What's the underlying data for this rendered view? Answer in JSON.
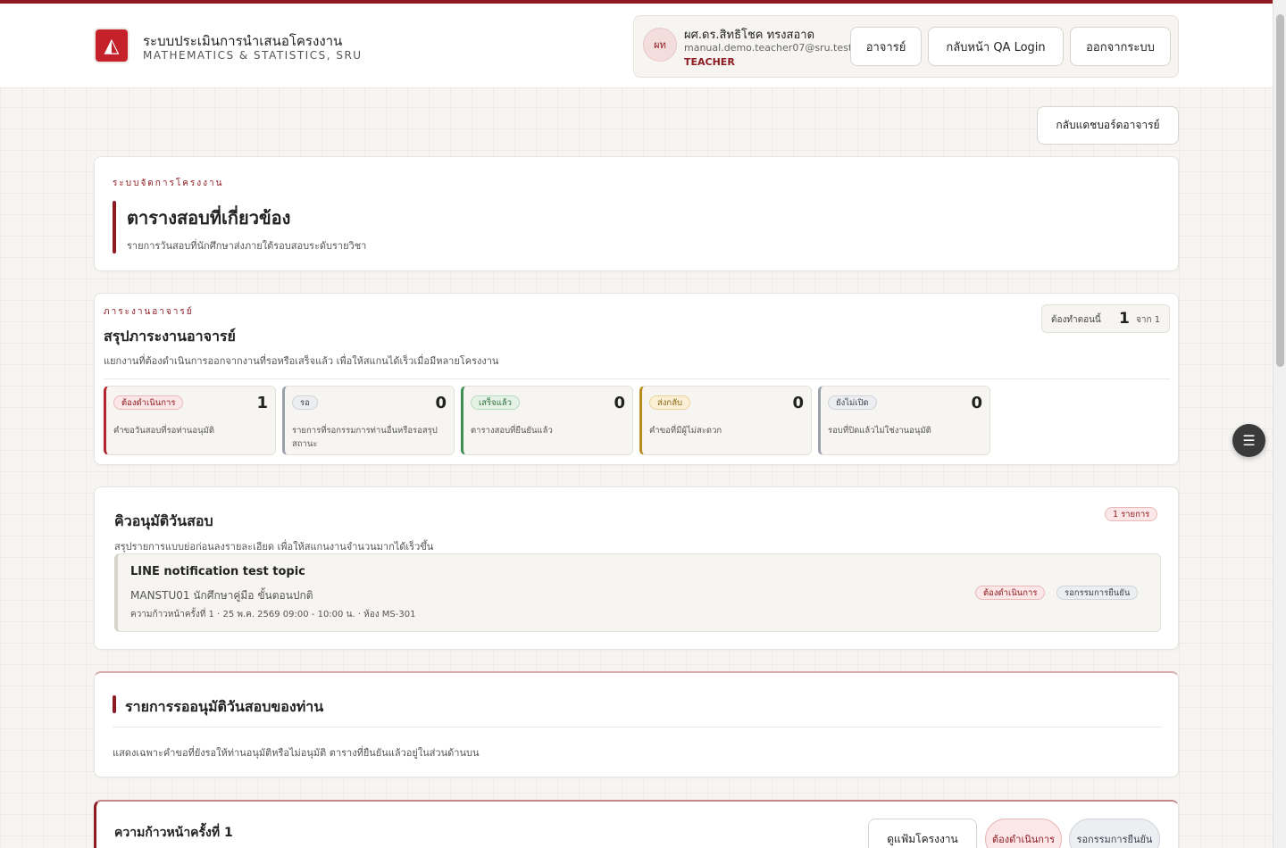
{
  "header": {
    "logo_text": "◭",
    "title": "ระบบประเมินการนำเสนอโครงงาน",
    "subtitle": "MATHEMATICS & STATISTICS, SRU",
    "user": {
      "initials": "ผท",
      "name": "ผศ.ดร.สิทธิโชค ทรงสอาด",
      "email": "manual.demo.teacher07@sru.test",
      "role": "TEACHER"
    },
    "buttons": {
      "teacher": "อาจารย์",
      "qa_login": "กลับหน้า QA Login",
      "logout": "ออกจากระบบ"
    }
  },
  "back_dashboard": "กลับแดชบอร์ดอาจารย์",
  "hero": {
    "eyebrow": "ระบบจัดการโครงงาน",
    "title": "ตารางสอบที่เกี่ยวข้อง",
    "desc": "รายการวันสอบที่นักศึกษาส่งภายใต้รอบสอบระดับรายวิชา"
  },
  "workload": {
    "eyebrow": "ภาระงานอาจารย์",
    "title": "สรุปภาระงานอาจารย์",
    "desc": "แยกงานที่ต้องดำเนินการออกจากงานที่รอหรือเสร็จแล้ว เพื่อให้สแกนได้เร็วเมื่อมีหลายโครงงาน",
    "now_label": "ต้องทำตอนนี้",
    "now_value": "1",
    "now_of": "จาก 1",
    "tiles": [
      {
        "label": "ต้องดำเนินการ",
        "count": "1",
        "desc": "คำขอวันสอบที่รอท่านอนุมัติ",
        "color": "#b3262e",
        "pill_bg": "#fbe7e7",
        "pill_border": "#e9b8b8",
        "pill_fg": "#8e1b22"
      },
      {
        "label": "รอ",
        "count": "0",
        "desc": "รายการที่รอกรรมการท่านอื่นหรือรอสรุปสถานะ",
        "color": "#9aa0aa",
        "pill_bg": "#eceef2",
        "pill_border": "#cfd3da",
        "pill_fg": "#3c4350"
      },
      {
        "label": "เสร็จแล้ว",
        "count": "0",
        "desc": "ตารางสอบที่ยืนยันแล้ว",
        "color": "#3f8f53",
        "pill_bg": "#e5f3e7",
        "pill_border": "#b5dbbd",
        "pill_fg": "#2b6e3b"
      },
      {
        "label": "ส่งกลับ",
        "count": "0",
        "desc": "คำขอที่มีผู้ไม่สะดวก",
        "color": "#b98a1c",
        "pill_bg": "#fbf0d6",
        "pill_border": "#ead39a",
        "pill_fg": "#8a6410"
      },
      {
        "label": "ยังไม่เปิด",
        "count": "0",
        "desc": "รอบที่ปิดแล้วไม่ใช่งานอนุมัติ",
        "color": "#9aa0aa",
        "pill_bg": "#eceef2",
        "pill_border": "#cfd3da",
        "pill_fg": "#3c4350"
      }
    ]
  },
  "queue": {
    "title": "คิวอนุมัติวันสอบ",
    "desc": "สรุปรายการแบบย่อก่อนลงรายละเอียด เพื่อให้สแกนงานจำนวนมากได้เร็วขึ้น",
    "count_badge": "1 รายการ",
    "item": {
      "title": "LINE notification test topic",
      "sub": "MANSTU01 นักศึกษาคู่มือ ขั้นตอนปกติ",
      "meta": "ความก้าวหน้าครั้งที่ 1 · 25 พ.ค. 2569 09:00 - 10:00 น. · ห้อง MS-301",
      "badge_action": "ต้องดำเนินการ",
      "badge_wait": "รอกรรมการยืนยัน"
    }
  },
  "pending": {
    "title": "รายการรออนุมัติวันสอบของท่าน",
    "desc": "แสดงเฉพาะคำขอที่ยังรอให้ท่านอนุมัติหรือไม่อนุมัติ ตารางที่ยืนยันแล้วอยู่ในส่วนด้านบน"
  },
  "progress": {
    "title": "ความก้าวหน้าครั้งที่ 1",
    "portfolio_btn": "ดูแฟ้มโครงงาน",
    "badge_action": "ต้องดำเนินการ",
    "badge_wait": "รอกรรมการยืนยัน"
  },
  "float_icon": "filter-list-icon"
}
